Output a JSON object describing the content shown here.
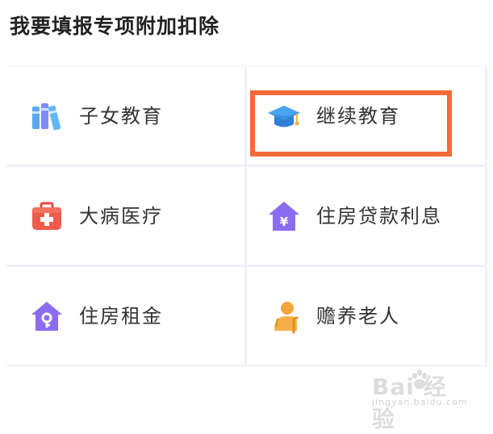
{
  "page": {
    "title": "我要填报专项附加扣除"
  },
  "items": [
    {
      "label": "子女教育",
      "icon": "books-icon"
    },
    {
      "label": "继续教育",
      "icon": "graduation-cap-icon"
    },
    {
      "label": "大病医疗",
      "icon": "medical-kit-icon"
    },
    {
      "label": "住房贷款利息",
      "icon": "house-yuan-icon"
    },
    {
      "label": "住房租金",
      "icon": "house-key-icon"
    },
    {
      "label": "赡养老人",
      "icon": "elderly-person-icon"
    }
  ],
  "watermark": {
    "brand": "Bai 经验",
    "site": "jingyan.baidu.com"
  },
  "colors": {
    "highlight": "#f26a38",
    "books": "#5aa8f0",
    "cap": "#3a92e3",
    "medical": "#ef5a4a",
    "house": "#8b6cf0",
    "elderly": "#f3a43b",
    "grid_bg": "#eef1f7"
  }
}
